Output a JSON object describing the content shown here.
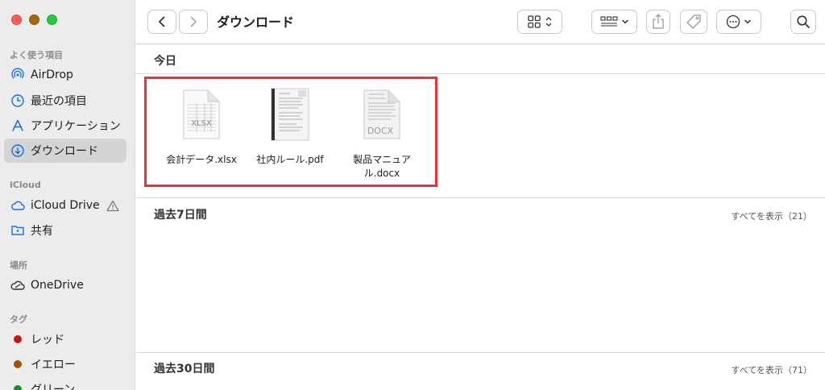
{
  "window": {
    "title": "ダウンロード"
  },
  "sidebar": {
    "sections": {
      "favorites": "よく使う項目",
      "icloud": "iCloud",
      "locations": "場所",
      "tags": "タグ"
    },
    "favorites": [
      {
        "label": "AirDrop",
        "icon": "airdrop-icon"
      },
      {
        "label": "最近の項目",
        "icon": "clock-icon"
      },
      {
        "label": "アプリケーション",
        "icon": "applications-icon"
      },
      {
        "label": "ダウンロード",
        "icon": "download-icon",
        "selected": true
      }
    ],
    "icloud": [
      {
        "label": "iCloud Drive",
        "icon": "cloud-icon"
      },
      {
        "label": "共有",
        "icon": "shared-folder-icon"
      }
    ],
    "locations": [
      {
        "label": "OneDrive",
        "icon": "onedrive-icon"
      }
    ],
    "tags": [
      {
        "label": "レッド",
        "color": "#c81414"
      },
      {
        "label": "イエロー",
        "color": "#a0520c"
      },
      {
        "label": "グリーン",
        "color": "#1f8a2a"
      }
    ]
  },
  "content": {
    "sections": [
      {
        "title": "今日",
        "show_all": ""
      },
      {
        "title": "過去7日間",
        "show_all": "すべてを表示（21）"
      },
      {
        "title": "過去30日間",
        "show_all": "すべてを表示（71）"
      }
    ],
    "today_files": [
      {
        "name": "会計データ.xlsx",
        "thumb_label": "XLSX",
        "type": "spreadsheet"
      },
      {
        "name": "社内ルール.pdf",
        "thumb_label": "",
        "type": "pdf"
      },
      {
        "name": "製品マニュアル.docx",
        "thumb_label": "DOCX",
        "type": "document"
      }
    ]
  },
  "colors": {
    "highlight": "#e8323a",
    "selected_bg": "#d4d4d6",
    "accent": "#1a6fd8"
  }
}
